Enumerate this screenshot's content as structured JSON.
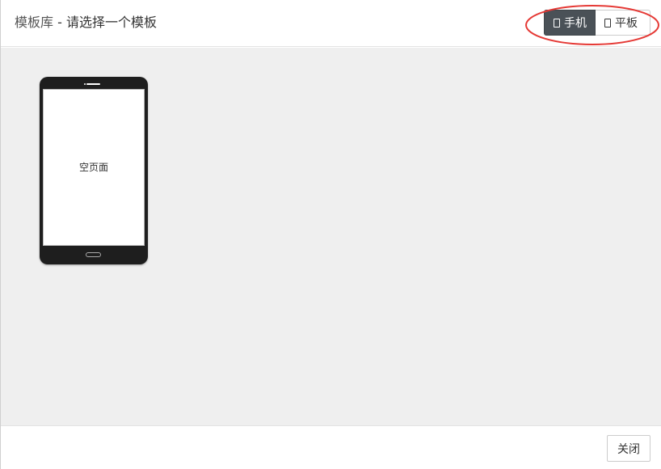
{
  "dialog": {
    "title_prefix": "模板库",
    "title_separator": " - ",
    "title_text": "请选择一个模板"
  },
  "device_toggle": {
    "options": [
      {
        "label": "手机",
        "icon": "phone-icon",
        "selected": true
      },
      {
        "label": "平板",
        "icon": "tablet-icon",
        "selected": false
      }
    ],
    "highlight_color": "#e53935"
  },
  "templates": [
    {
      "label": "空页面"
    }
  ],
  "footer": {
    "close_label": "关闭"
  },
  "colors": {
    "active_toggle": "#4a5157",
    "body_background": "#efefef",
    "phone_frame": "#1e1e1e"
  }
}
